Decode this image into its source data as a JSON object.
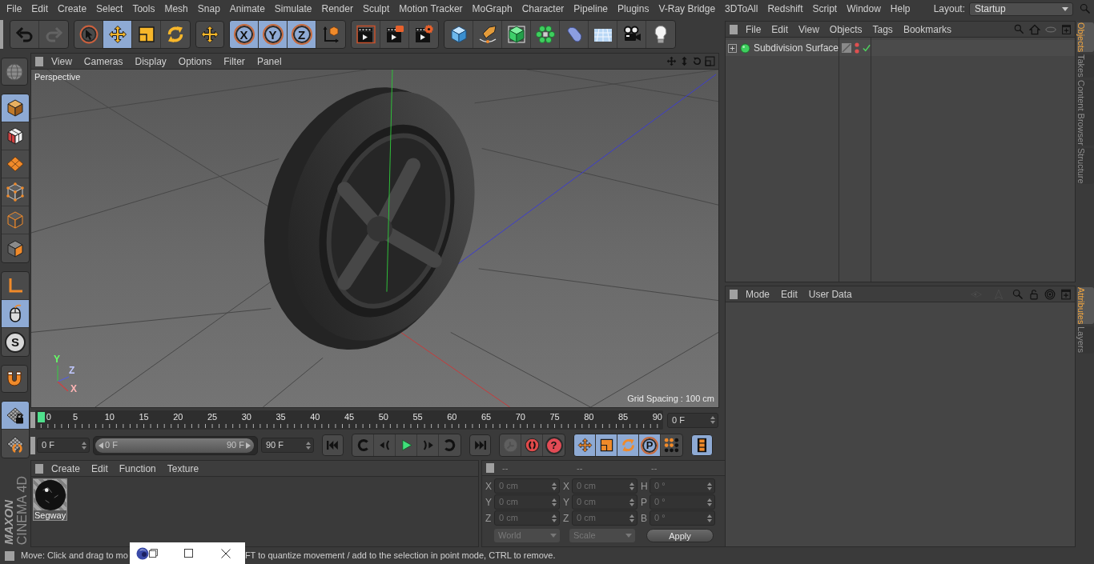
{
  "menu_bar": {
    "items": [
      "File",
      "Edit",
      "Create",
      "Select",
      "Tools",
      "Mesh",
      "Snap",
      "Animate",
      "Simulate",
      "Render",
      "Sculpt",
      "Motion Tracker",
      "MoGraph",
      "Character",
      "Pipeline",
      "Plugins",
      "V-Ray Bridge",
      "3DToAll",
      "Redshift",
      "Script",
      "Window",
      "Help"
    ],
    "layout_label": "Layout:",
    "layout_value": "Startup"
  },
  "toolbar": {
    "groups": [
      {
        "buttons": [
          {
            "kind": "undo",
            "selected": false,
            "disabled": false
          },
          {
            "kind": "redo",
            "selected": false,
            "disabled": true
          }
        ]
      },
      {
        "buttons": [
          {
            "kind": "select",
            "selected": false,
            "disabled": false
          },
          {
            "kind": "move",
            "selected": true,
            "disabled": false
          },
          {
            "kind": "scale",
            "selected": false,
            "disabled": false
          },
          {
            "kind": "rotate",
            "selected": false,
            "disabled": false
          }
        ]
      },
      {
        "buttons": [
          {
            "kind": "move",
            "selected": false,
            "disabled": false
          }
        ]
      },
      {
        "buttons": [
          {
            "kind": "axis-lock",
            "label": "X",
            "selected": true,
            "disabled": false
          },
          {
            "kind": "axis-lock",
            "label": "Y",
            "selected": true,
            "disabled": false
          },
          {
            "kind": "axis-lock",
            "label": "Z",
            "selected": true,
            "disabled": false
          },
          {
            "kind": "coord-system",
            "selected": false,
            "disabled": false
          }
        ]
      },
      {
        "buttons": [
          {
            "kind": "render-view",
            "selected": false,
            "disabled": false
          },
          {
            "kind": "render-picture",
            "selected": false,
            "disabled": false
          },
          {
            "kind": "render-settings",
            "selected": false,
            "disabled": false
          }
        ]
      },
      {
        "buttons": [
          {
            "kind": "cube",
            "selected": false,
            "disabled": false
          },
          {
            "kind": "pen",
            "selected": false,
            "disabled": false
          },
          {
            "kind": "subdivision",
            "selected": false,
            "disabled": false
          },
          {
            "kind": "cloner",
            "selected": false,
            "disabled": false
          },
          {
            "kind": "deformer",
            "selected": false,
            "disabled": false
          },
          {
            "kind": "floor",
            "selected": false,
            "disabled": false
          },
          {
            "kind": "camera",
            "selected": false,
            "disabled": false
          },
          {
            "kind": "light",
            "selected": false,
            "disabled": false
          }
        ]
      }
    ]
  },
  "left_toolbar": {
    "groups": [
      {
        "buttons": [
          {
            "kind": "viewport",
            "selected": false
          }
        ]
      },
      {
        "buttons": [
          {
            "kind": "model",
            "selected": true
          },
          {
            "kind": "texture",
            "selected": false
          },
          {
            "kind": "workplane",
            "selected": false
          },
          {
            "kind": "points",
            "selected": false
          },
          {
            "kind": "edges",
            "selected": false
          },
          {
            "kind": "polygons",
            "selected": false
          }
        ]
      },
      {
        "buttons": [
          {
            "kind": "axis-mode",
            "selected": false
          },
          {
            "kind": "tweak",
            "selected": true
          },
          {
            "kind": "snap",
            "label": "S",
            "selected": false
          }
        ]
      },
      {
        "buttons": [
          {
            "kind": "magnet",
            "selected": false
          }
        ]
      },
      {
        "buttons": [
          {
            "kind": "grid-lock",
            "selected": true
          },
          {
            "kind": "grid-rotate",
            "selected": false
          }
        ]
      }
    ]
  },
  "logo": {
    "brand": "MAXON",
    "product": "CINEMA 4D"
  },
  "viewport": {
    "menu": [
      "View",
      "Cameras",
      "Display",
      "Options",
      "Filter",
      "Panel"
    ],
    "camera_label": "Perspective",
    "grid_spacing": "Grid Spacing : 100 cm",
    "axis_labels": [
      {
        "text": "Y",
        "color": "#66ff66"
      },
      {
        "text": "Z",
        "color": "#c0c8ff"
      },
      {
        "text": "X",
        "color": "#ffb4b4"
      }
    ]
  },
  "timeline": {
    "ticks": [
      {
        "label": "0",
        "selected": true
      },
      {
        "label": "5",
        "selected": false
      },
      {
        "label": "10",
        "selected": false
      },
      {
        "label": "15",
        "selected": false
      },
      {
        "label": "20",
        "selected": false
      },
      {
        "label": "25",
        "selected": false
      },
      {
        "label": "30",
        "selected": false
      },
      {
        "label": "35",
        "selected": false
      },
      {
        "label": "40",
        "selected": false
      },
      {
        "label": "45",
        "selected": false
      },
      {
        "label": "50",
        "selected": false
      },
      {
        "label": "55",
        "selected": false
      },
      {
        "label": "60",
        "selected": false
      },
      {
        "label": "65",
        "selected": false
      },
      {
        "label": "70",
        "selected": false
      },
      {
        "label": "75",
        "selected": false
      },
      {
        "label": "80",
        "selected": false
      },
      {
        "label": "85",
        "selected": false
      },
      {
        "label": "90",
        "selected": false
      }
    ],
    "current_frame": "0 F"
  },
  "transport": {
    "start_frame": "0 F",
    "range_slider": {
      "start": "0 F",
      "end": "90 F",
      "level": 1
    },
    "end_frame": "90 F",
    "groups": [
      {
        "buttons": [
          {
            "kind": "go-start",
            "selected": false,
            "disabled": false
          }
        ]
      },
      {
        "buttons": [
          {
            "kind": "prev-key",
            "selected": false,
            "disabled": false
          },
          {
            "kind": "prev-frame",
            "selected": false,
            "disabled": false
          },
          {
            "kind": "play",
            "selected": false,
            "disabled": false
          },
          {
            "kind": "next-frame",
            "selected": false,
            "disabled": false
          },
          {
            "kind": "next-key",
            "selected": false,
            "disabled": false
          }
        ]
      },
      {
        "buttons": [
          {
            "kind": "go-end",
            "selected": false,
            "disabled": false
          }
        ]
      },
      {
        "buttons": [
          {
            "kind": "key",
            "selected": false,
            "disabled": true
          },
          {
            "kind": "autokey",
            "selected": false,
            "disabled": false
          },
          {
            "kind": "help",
            "label": "?",
            "selected": false,
            "disabled": false
          }
        ]
      },
      {
        "buttons": [
          {
            "kind": "move-key",
            "selected": true,
            "disabled": false
          },
          {
            "kind": "scale-key",
            "selected": true,
            "disabled": false
          },
          {
            "kind": "rotate-key",
            "selected": true,
            "disabled": false
          },
          {
            "kind": "param-key",
            "label": "P",
            "selected": true,
            "disabled": false
          },
          {
            "kind": "point-key",
            "selected": false,
            "disabled": false
          }
        ]
      },
      {
        "buttons": [
          {
            "kind": "film",
            "selected": true,
            "disabled": false
          }
        ]
      }
    ]
  },
  "materials": {
    "menu": [
      "Create",
      "Edit",
      "Function",
      "Texture"
    ],
    "items": [
      {
        "name": "Segway"
      }
    ]
  },
  "coordinates": {
    "disabled": true,
    "headers": [
      "--",
      "--",
      "--"
    ],
    "rows": [
      {
        "fields": [
          {
            "label": "X",
            "value": "0 cm"
          },
          {
            "label": "X",
            "value": "0 cm"
          },
          {
            "label": "H",
            "value": "0 °"
          }
        ]
      },
      {
        "fields": [
          {
            "label": "Y",
            "value": "0 cm"
          },
          {
            "label": "Y",
            "value": "0 cm"
          },
          {
            "label": "P",
            "value": "0 °"
          }
        ]
      },
      {
        "fields": [
          {
            "label": "Z",
            "value": "0 cm"
          },
          {
            "label": "Z",
            "value": "0 cm"
          },
          {
            "label": "B",
            "value": "0 °"
          }
        ]
      }
    ],
    "dropdowns": [
      "World",
      "Scale"
    ],
    "apply": "Apply"
  },
  "objects_panel": {
    "menu": [
      "File",
      "Edit",
      "View",
      "Objects",
      "Tags",
      "Bookmarks"
    ],
    "objects": [
      {
        "name": "Subdivision Surface",
        "expanded": false,
        "enabled": true
      }
    ]
  },
  "side_tabs_top": [
    {
      "label": "Objects",
      "selected": true
    },
    {
      "label": "Takes",
      "selected": false
    },
    {
      "label": "Content Browser",
      "selected": false
    },
    {
      "label": "Structure",
      "selected": false
    }
  ],
  "attributes_panel": {
    "menu": [
      "Mode",
      "Edit",
      "User Data"
    ],
    "tools": [
      {
        "kind": "back",
        "disabled": true
      },
      {
        "kind": "up",
        "disabled": true
      },
      {
        "kind": "search",
        "disabled": false
      },
      {
        "kind": "lock",
        "disabled": false
      },
      {
        "kind": "target",
        "disabled": false
      },
      {
        "kind": "new-panel",
        "disabled": false
      }
    ]
  },
  "side_tabs_bottom": [
    {
      "label": "Attributes",
      "selected": true
    },
    {
      "label": "Layers",
      "selected": false
    }
  ],
  "status_bar": {
    "texts": [
      "Move: Click and drag to mo",
      "FT to quantize movement / add to the selection in point mode, CTRL to remove."
    ]
  }
}
